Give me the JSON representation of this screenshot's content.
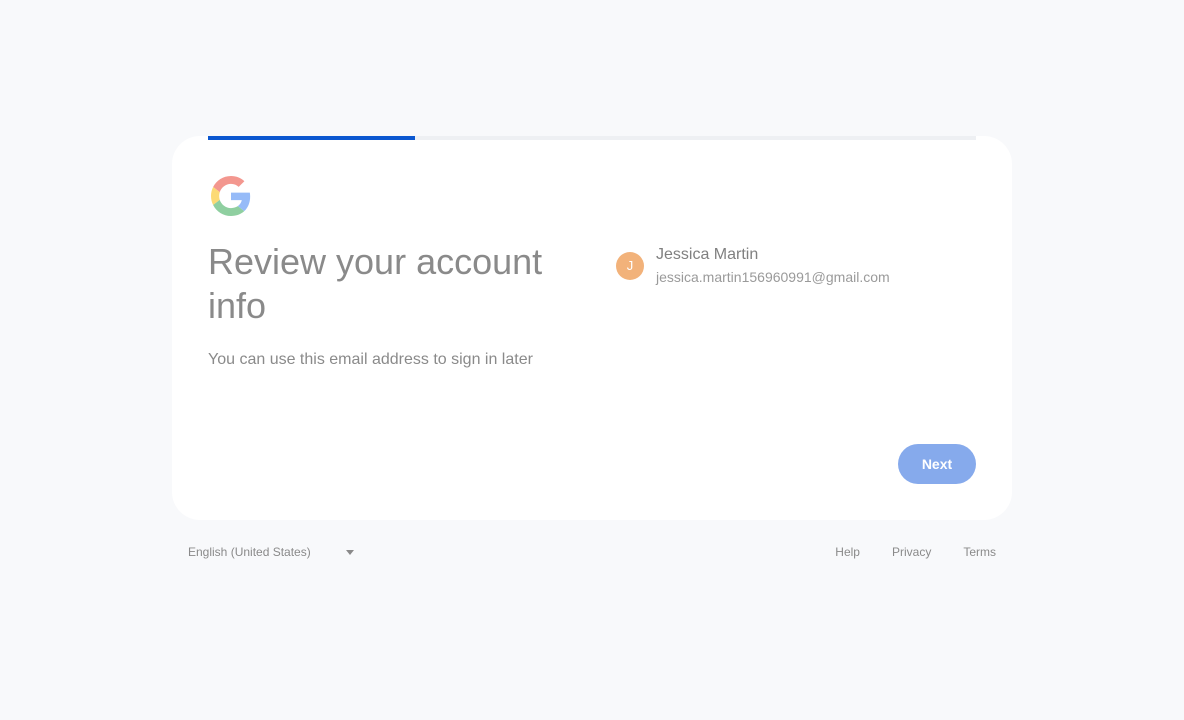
{
  "progress": {
    "fraction": 0.27,
    "color": "#0b57d0"
  },
  "logo": {
    "icon": "google-g-icon",
    "colors": [
      "#ea4335",
      "#fbbc05",
      "#34a853",
      "#4285f4"
    ]
  },
  "main": {
    "heading": "Review your account info",
    "subtitle": "You can use this email address to sign in later"
  },
  "account": {
    "avatar_letter": "J",
    "avatar_color": "#f2b27a",
    "name": "Jessica Martin",
    "email": "jessica.martin156960991@gmail.com"
  },
  "actions": {
    "next_label": "Next",
    "accent": "#86aaec"
  },
  "footer": {
    "language": "English (United States)",
    "language_icon": "caret-down-icon",
    "links": [
      "Help",
      "Privacy",
      "Terms"
    ]
  }
}
